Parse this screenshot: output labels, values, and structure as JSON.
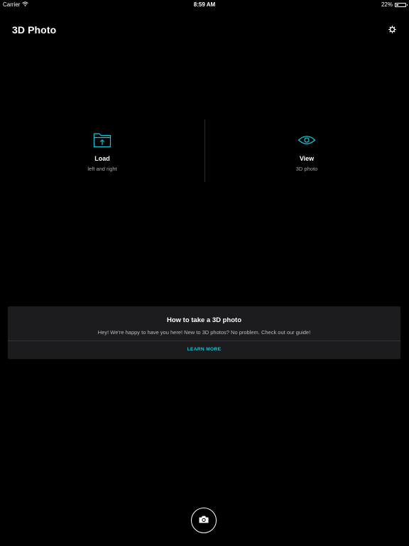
{
  "status_bar": {
    "carrier": "Carrier",
    "time": "8:59 AM",
    "battery_text": "22%",
    "battery_level": 0.22,
    "icons": [
      "wifi-icon",
      "battery-icon"
    ]
  },
  "header": {
    "title": "3D Photo",
    "settings_icon": "settings-icon"
  },
  "actions": {
    "load": {
      "label": "Load",
      "sublabel": "left and right",
      "icon": "folder-upload-icon"
    },
    "view": {
      "label": "View",
      "sublabel": "3D photo",
      "icon": "eye-icon"
    }
  },
  "guide": {
    "title": "How to take a 3D photo",
    "text": "Hey! We're happy to have you here! New to 3D photos? No problem. Check out our guide!",
    "button_label": "LEARN MORE"
  },
  "camera": {
    "icon": "camera-icon"
  },
  "colors": {
    "background": "#000000",
    "accent": "#13c3d6",
    "card": "#1c1c1e",
    "secondary_text": "#a9a9a9"
  }
}
